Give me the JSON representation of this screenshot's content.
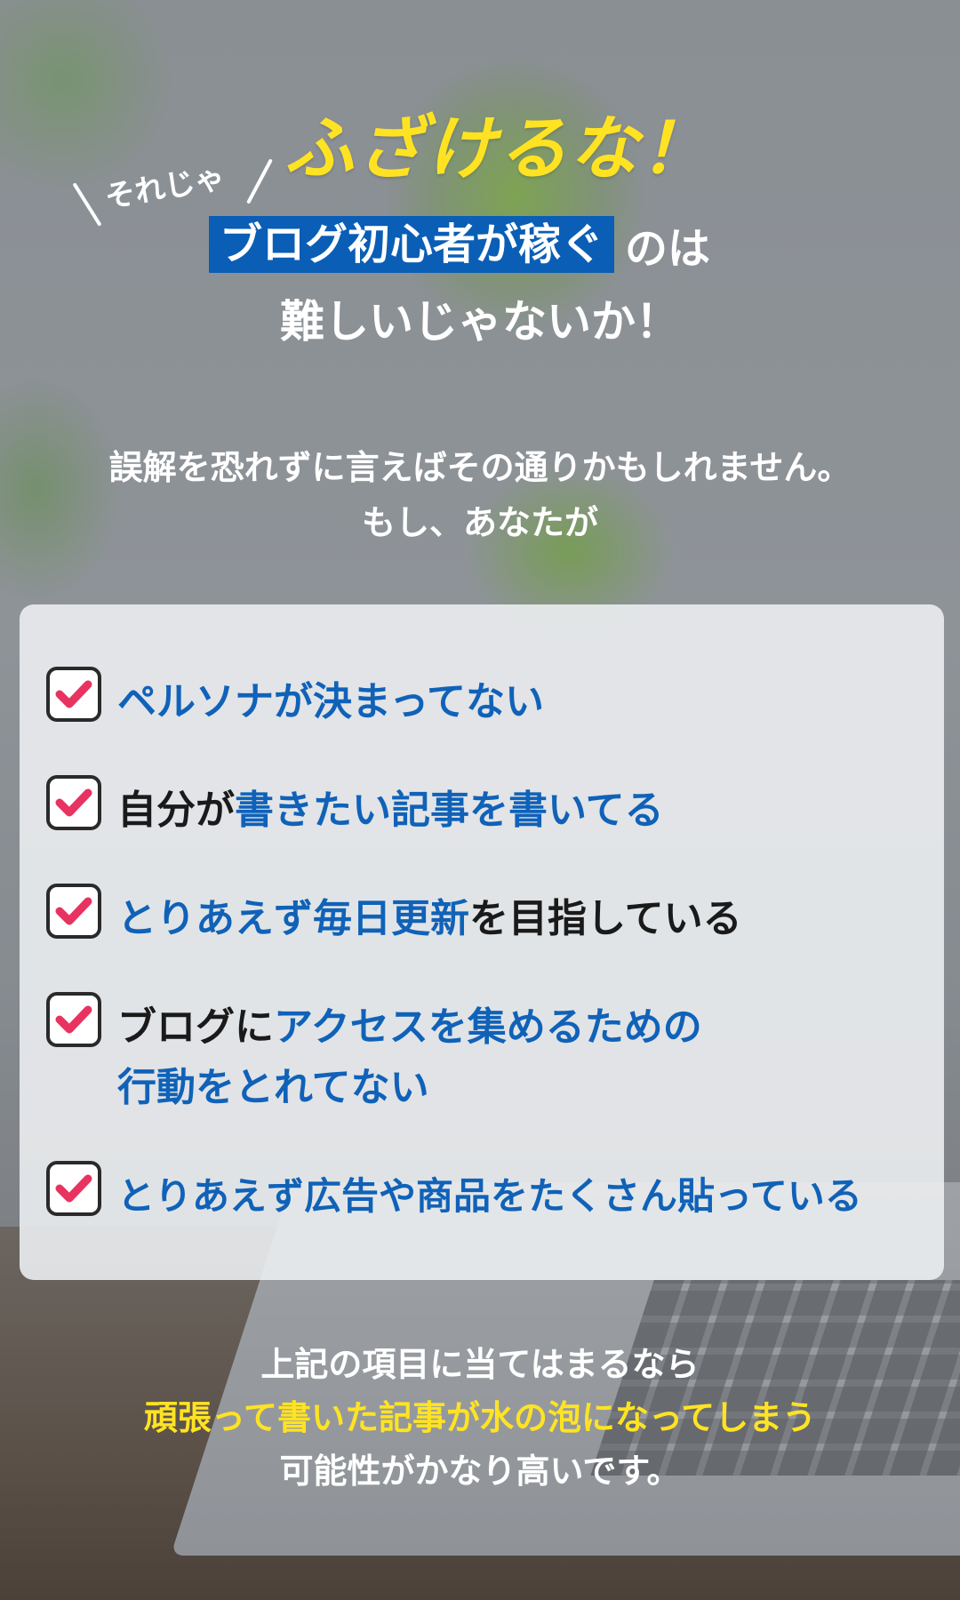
{
  "headline": {
    "shout": "ふざけるな！",
    "prefix": "それじゃ",
    "highlight": "ブログ初心者が稼ぐ",
    "highlight_suffix": "のは",
    "line3": "難しいじゃないか！"
  },
  "intro": {
    "line1": "誤解を恐れずに言えばその通りかもしれません。",
    "line2": "もし、あなたが"
  },
  "checklist": [
    {
      "parts": [
        {
          "text": "ペルソナが決まってない",
          "color": "blue"
        }
      ]
    },
    {
      "parts": [
        {
          "text": "自分が",
          "color": "black"
        },
        {
          "text": "書きたい記事を書いてる",
          "color": "blue"
        }
      ]
    },
    {
      "parts": [
        {
          "text": "とりあえず毎日更新",
          "color": "blue"
        },
        {
          "text": "を目指している",
          "color": "black"
        }
      ]
    },
    {
      "parts": [
        {
          "text": "ブログに",
          "color": "black"
        },
        {
          "text": "アクセスを集めるための",
          "color": "blue"
        }
      ],
      "line2": "行動をとれてない"
    },
    {
      "parts": [
        {
          "text": "とりあえず広告や商品をたくさん貼っている",
          "color": "blue"
        }
      ]
    }
  ],
  "closing": {
    "line1": "上記の項目に当てはまるなら",
    "line2": "頑張って書いた記事が水の泡になってしまう",
    "line3": "可能性がかなり高いです。"
  },
  "colors": {
    "accent_yellow": "#ffe323",
    "highlight_blue": "#0a5eb5",
    "text_blue": "#1062b8",
    "check_pink": "#e8325f"
  },
  "icons": {
    "checkbox": "checked-checkbox-icon"
  }
}
